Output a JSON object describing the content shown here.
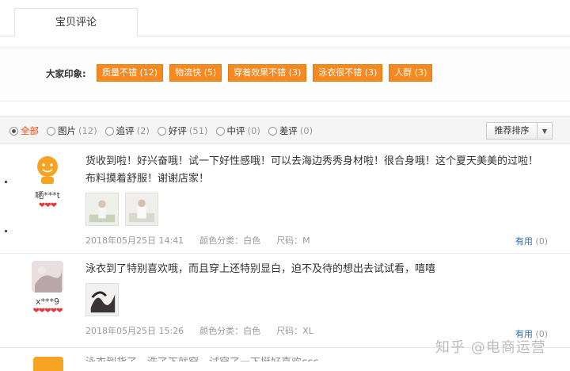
{
  "tab": {
    "label": "宝贝评论"
  },
  "impressions": {
    "label": "大家印象:",
    "tags": [
      "质量不错 (12)",
      "物流快 (5)",
      "穿着效果不错 (3)",
      "泳衣很不错 (3)",
      "人群 (3)"
    ]
  },
  "filter": {
    "options": [
      {
        "label": "全部",
        "count": ""
      },
      {
        "label": "图片",
        "count": "(12)"
      },
      {
        "label": "追评",
        "count": "(2)"
      },
      {
        "label": "好评",
        "count": "(51)"
      },
      {
        "label": "中评",
        "count": "(0)"
      },
      {
        "label": "差评",
        "count": "(0)"
      }
    ],
    "selected": "全部",
    "sort_label": "推荐排序",
    "sort_arrow": "▼"
  },
  "reviews": [
    {
      "user": "嗮***t",
      "hearts": "❤❤❤",
      "text": "货收到啦！好兴奋哦！试一下好性感哦！可以去海边秀秀身材啦！很合身哦！这个夏天美美的过啦！布料摸着舒服！谢谢店家！",
      "date": "2018年05月25日 14:41",
      "color": "颜色分类：白色",
      "size": "尺码：M",
      "useful_label": "有用",
      "useful_count": "(0)"
    },
    {
      "user": "x***9",
      "hearts": "❤❤❤❤❤",
      "text": "泳衣到了特别喜欢哦，而且穿上还特别显白，迫不及待的想出去试试看，嘻嘻",
      "date": "2018年05月25日 15:26",
      "color": "颜色分类：白色",
      "size": "尺码：XL",
      "useful_label": "有用",
      "useful_count": "(0)"
    }
  ],
  "partial_review_text": "泳衣到货了，洗了下就穿，试穿了一下挺好喜欢ccc",
  "watermark": "知乎 @电商运营",
  "colors": {
    "tag_orange": "#f6891f",
    "link_blue": "#2d6ebf",
    "active_red": "#ff4400"
  }
}
